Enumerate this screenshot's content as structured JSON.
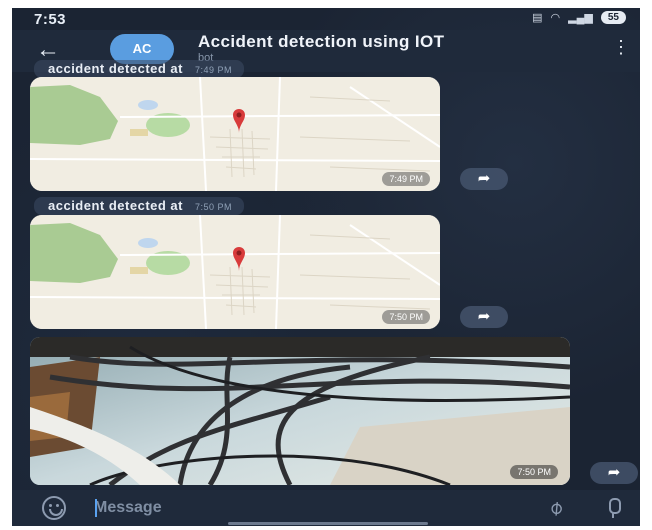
{
  "status_bar": {
    "time": "7:53",
    "icons": [
      "volte-icon",
      "wifi-icon",
      "signal-icon"
    ],
    "battery": "55"
  },
  "header": {
    "avatar_initials": "AC",
    "title": "Accident detection using IOT",
    "subtitle": "bot",
    "avatar_color": "#5a9de0"
  },
  "messages": [
    {
      "caption": "accident detected at",
      "caption_time": "7:49 PM",
      "map_time": "7:49 PM"
    },
    {
      "caption": "accident detected at",
      "caption_time": "7:50 PM",
      "map_time": "7:50 PM"
    },
    {
      "photo_time": "7:50 PM"
    }
  ],
  "input": {
    "placeholder": "Message"
  },
  "colors": {
    "background": "#1b2433",
    "header": "#1f2a3b",
    "pin": "#d83b3b",
    "accent": "#5aa2f0"
  }
}
